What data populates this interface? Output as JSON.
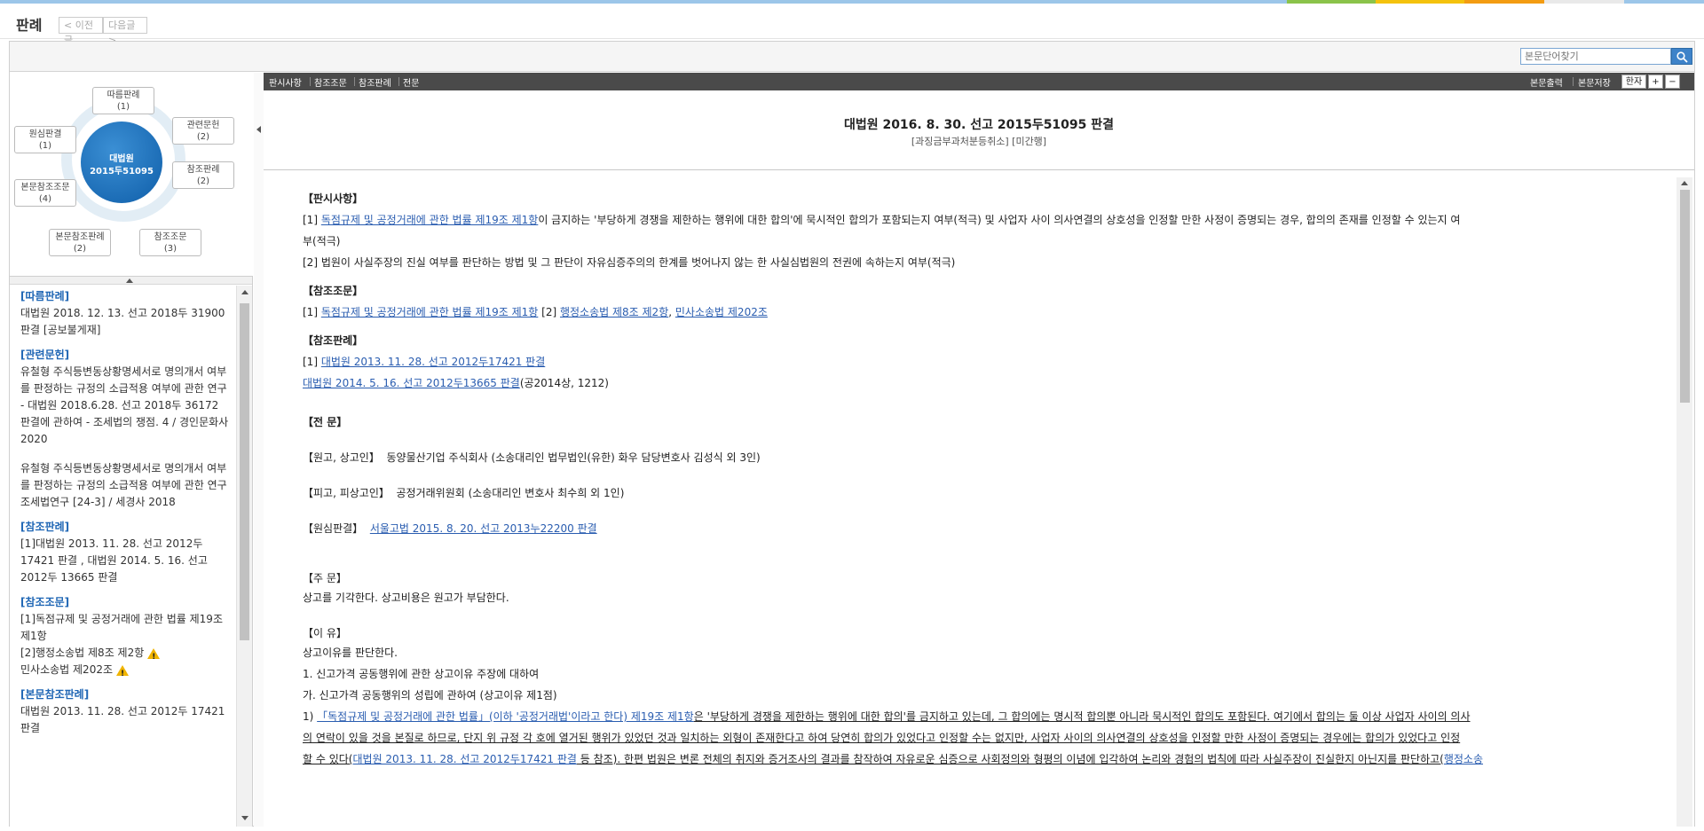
{
  "page": {
    "title": "판례",
    "prev_label": "< 이전글",
    "next_label": "다음글 >"
  },
  "search": {
    "placeholder": "본문단어찾기"
  },
  "diagram": {
    "center_line1": "대법원",
    "center_line2": "2015두51095",
    "nodes": [
      {
        "label": "따름판례",
        "count": "(1)"
      },
      {
        "label": "관련문헌",
        "count": "(2)"
      },
      {
        "label": "참조판례",
        "count": "(2)"
      },
      {
        "label": "참조조문",
        "count": "(3)"
      },
      {
        "label": "본문참조판례",
        "count": "(2)"
      },
      {
        "label": "본문참조조문",
        "count": "(4)"
      },
      {
        "label": "원심판결",
        "count": "(1)"
      }
    ]
  },
  "left_list": {
    "follow_h": "[따름판례]",
    "follow_p": "대법원 2018. 12. 13. 선고 2018두 31900 판결 [공보불게재]",
    "lit_h": "[관련문헌]",
    "lit_p1": "유철형 주식등변동상황명세서로 명의개서 여부를 판정하는 규정의 소급적용 여부에 관한 연구 - 대법원 2018.6.28. 선고 2018두 36172 판결에 관하여 - 조세법의 쟁점. 4 / 경인문화사 2020",
    "lit_p2": "유철형 주식등변동상황명세서로 명의개서 여부를 판정하는 규정의 소급적용 여부에 관한 연구 조세법연구 [24-3] / 세경사 2018",
    "ref_case_h": "[참조판례]",
    "ref_case_p": "[1]대법원 2013. 11. 28. 선고 2012두17421 판결 , 대법원 2014. 5. 16. 선고 2012두 13665 판결",
    "ref_law_h": "[참조조문]",
    "ref_law_p1": "[1]독점규제 및 공정거래에 관한 법률 제19조 제1항",
    "ref_law_p2": "[2]행정소송법 제8조 제2항",
    "ref_law_p3": "민사소송법 제202조",
    "body_ref_h": "[본문참조판례]",
    "body_ref_p": "대법원 2013. 11. 28. 선고 2012두 17421 판결"
  },
  "toolbar": {
    "tabs": [
      "판시사항",
      "참조조문",
      "참조판례",
      "전문"
    ],
    "print": "본문출력",
    "save": "본문저장",
    "hanja": "한자",
    "plus": "+",
    "minus": "−"
  },
  "doc": {
    "title": "대법원 2016. 8. 30. 선고 2015두51095 판결",
    "subtitle": "[과징금부과처분등취소] [미간행]",
    "h_pansi": "【판시사항】",
    "pansi1_pre": "[1] ",
    "pansi1_link": "독점규제 및 공정거래에 관한 법률 제19조 제1항",
    "pansi1_rest": "이 금지하는 '부당하게 경쟁을 제한하는 행위에 대한 합의'에 묵시적인 합의가 포함되는지 여부(적극) 및 사업자 사이 의사연결의 상호성을 인정할 만한 사정이 증명되는 경우, 합의의 존재를 인정할 수 있는지 여",
    "pansi1_cont": "부(적극)",
    "pansi2": "[2] 법원이 사실주장의 진실 여부를 판단하는 방법 및 그 판단이 자유심증주의의 한계를 벗어나지 않는 한 사실심법원의 전권에 속하는지 여부(적극)",
    "h_ref_law": "【참조조문】",
    "ref_law_pre": "[1] ",
    "ref_law_link1": "독점규제 및 공정거래에 관한 법률 제19조 제1항",
    "ref_law_mid": " [2] ",
    "ref_law_link2": "행정소송법 제8조 제2항",
    "ref_law_comma": ", ",
    "ref_law_link3": "민사소송법 제202조",
    "h_ref_case": "【참조판례】",
    "ref_case_pre": "[1] ",
    "ref_case_link1": "대법원 2013. 11. 28. 선고 2012두17421 판결",
    "ref_case_link2": "대법원 2014. 5. 16. 선고 2012두13665 판결",
    "ref_case_rest": "(공2014상, 1212)",
    "h_full": "【전 문】",
    "plaintiff_label": "【원고, 상고인】",
    "plaintiff": "동양물산기업 주식회사 (소송대리인 법무법인(유한) 화우 담당변호사 김성식 외 3인)",
    "defendant_label": "【피고, 피상고인】",
    "defendant": "공정거래위원회 (소송대리인 변호사 최수희 외 1인)",
    "orig_label": "【원심판결】",
    "orig_link": "서울고법 2015. 8. 20. 선고 2013누22200 판결",
    "h_order": "【주 문】",
    "order": "상고를 기각한다. 상고비용은 원고가 부담한다.",
    "h_reason": "【이 유】",
    "reason_intro": "상고이유를 판단한다.",
    "r1": "1. 신고가격 공동행위에 관한 상고이유 주장에 대하여",
    "r_ga": "가. 신고가격 공동행위의 성립에 관하여 (상고이유 제1점)",
    "p1_pre": "1) ",
    "p1_link": "「독점규제 및 공정거래에 관한 법률」(이하 '공정거래법'이라고 한다) 제19조 제1항",
    "p1_rest": "은 '부당하게 경쟁을 제한하는 행위에 대한 합의'를 금지하고 있는데, 그 합의에는 명시적 합의뿐 아니라 묵시적인 합의도 포함된다. 여기에서 합의는 둘 이상 사업자 사이의 의사",
    "p1_line2": "의 연락이 있을 것을 본질로 하므로, 단지 위 규정 각 호에 열거된 행위가 있었던 것과 일치하는 외형이 존재한다고 하여 당연히 합의가 있었다고 인정할 수는 없지만, 사업자 사이의 의사연결의 상호성을 인정할 만한 사정이 증명되는 경우에는 합의가 있었다고 인정",
    "p1_line3_pre": "할 수 있다(",
    "p1_line3_link": "대법원 2013. 11. 28. 선고 2012두17421 판결",
    "p1_line3_rest": " 등 참조). 한편 법원은 변론 전체의 취지와 증거조사의 결과를 참작하여 자유로운 심증으로 사회정의와 형평의 이념에 입각하여 논리와 경험의 법칙에 따라 사실주장이 진실한지 아닌지를 판단하고(",
    "p1_line3_link2": "행정소송"
  },
  "colors": {
    "accent": "#2067b5",
    "link": "#2a5db0",
    "toolbar": "#4a4a4a",
    "center": "#0f5ea9"
  }
}
